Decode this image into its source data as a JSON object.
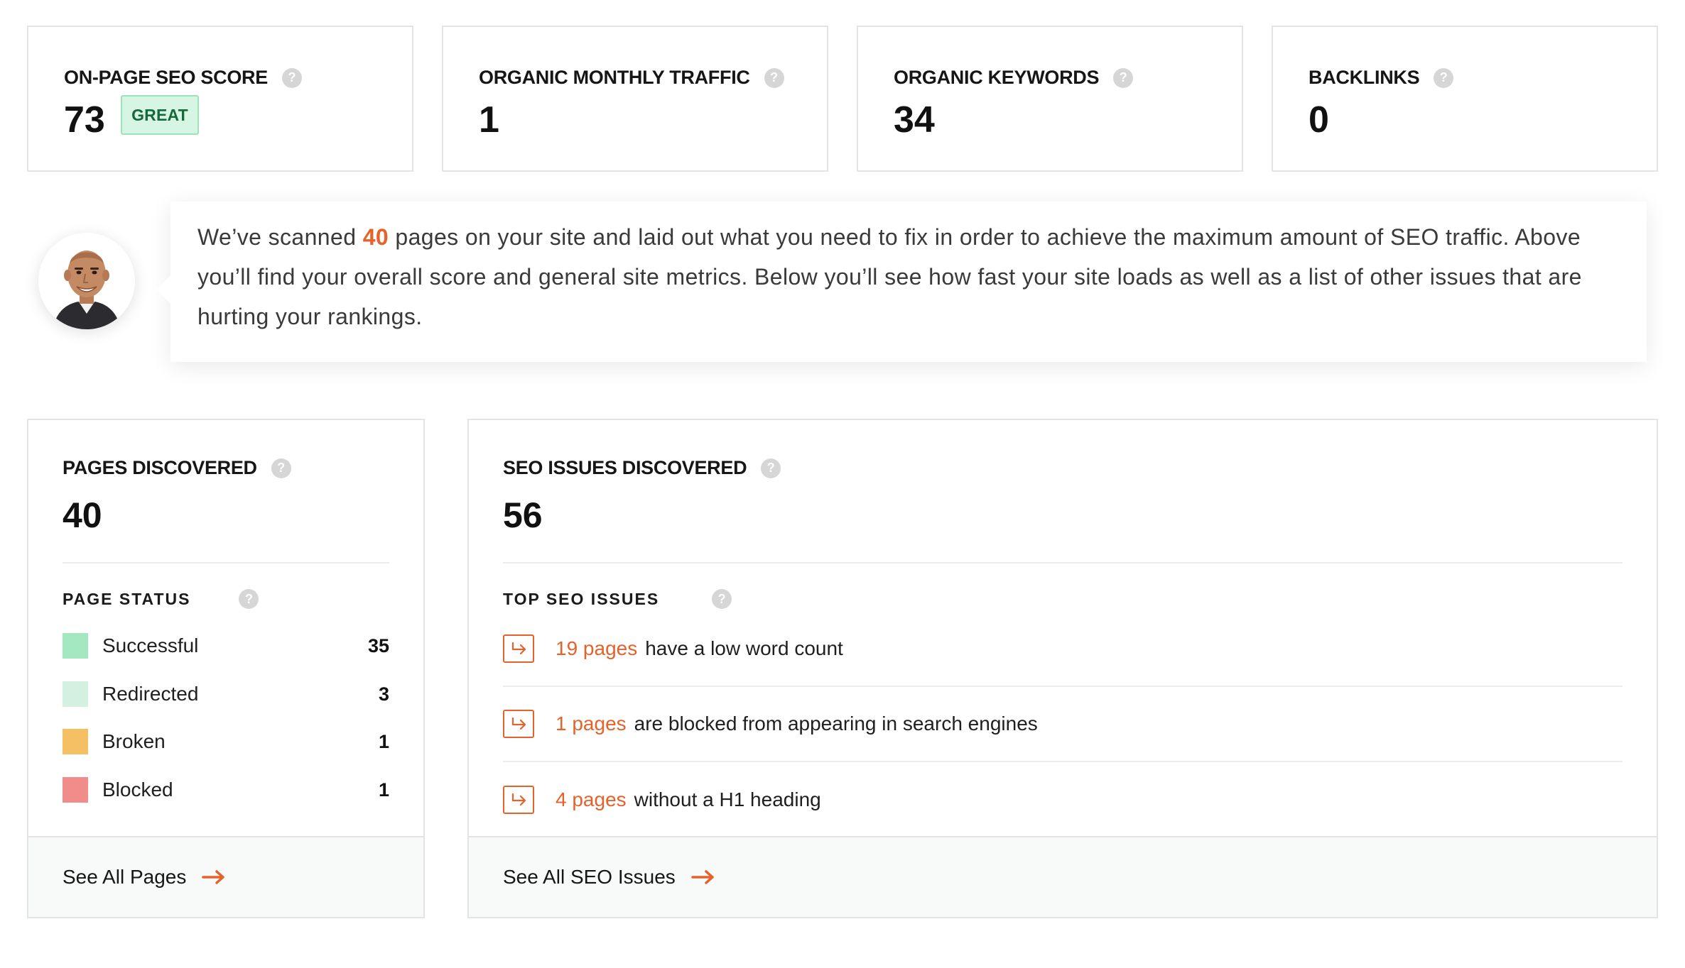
{
  "metrics": [
    {
      "title": "ON-PAGE SEO SCORE",
      "value": "73",
      "badge": "GREAT"
    },
    {
      "title": "ORGANIC MONTHLY TRAFFIC",
      "value": "1"
    },
    {
      "title": "ORGANIC KEYWORDS",
      "value": "34"
    },
    {
      "title": "BACKLINKS",
      "value": "0"
    }
  ],
  "help_glyph": "?",
  "message": {
    "prefix": "We’ve scanned ",
    "highlight": "40",
    "suffix": " pages on your site and laid out what you need to fix in order to achieve the maximum amount of SEO traffic. Above you’ll find your overall score and general site metrics. Below you’ll see how fast your site loads as well as a list of other issues that are hurting your rankings."
  },
  "pages": {
    "title": "PAGES DISCOVERED",
    "value": "40",
    "status_title": "PAGE STATUS",
    "statuses": [
      {
        "label": "Successful",
        "count": "35",
        "color": "#a3e8c1"
      },
      {
        "label": "Redirected",
        "count": "3",
        "color": "#d3f0e0"
      },
      {
        "label": "Broken",
        "count": "1",
        "color": "#f5bf63"
      },
      {
        "label": "Blocked",
        "count": "1",
        "color": "#f08c8a"
      }
    ],
    "footer_label": "See All Pages"
  },
  "issues": {
    "title": "SEO ISSUES DISCOVERED",
    "value": "56",
    "top_title": "TOP SEO ISSUES",
    "items": [
      {
        "count": "19 pages",
        "text": "have a low word count"
      },
      {
        "count": "1 pages",
        "text": "are blocked from appearing in search engines"
      },
      {
        "count": "4 pages",
        "text": "without a H1 heading"
      }
    ],
    "footer_label": "See All SEO Issues"
  },
  "colors": {
    "accent": "#e5622a",
    "badge_bg": "#d6f5e3",
    "badge_text": "#17683d"
  }
}
